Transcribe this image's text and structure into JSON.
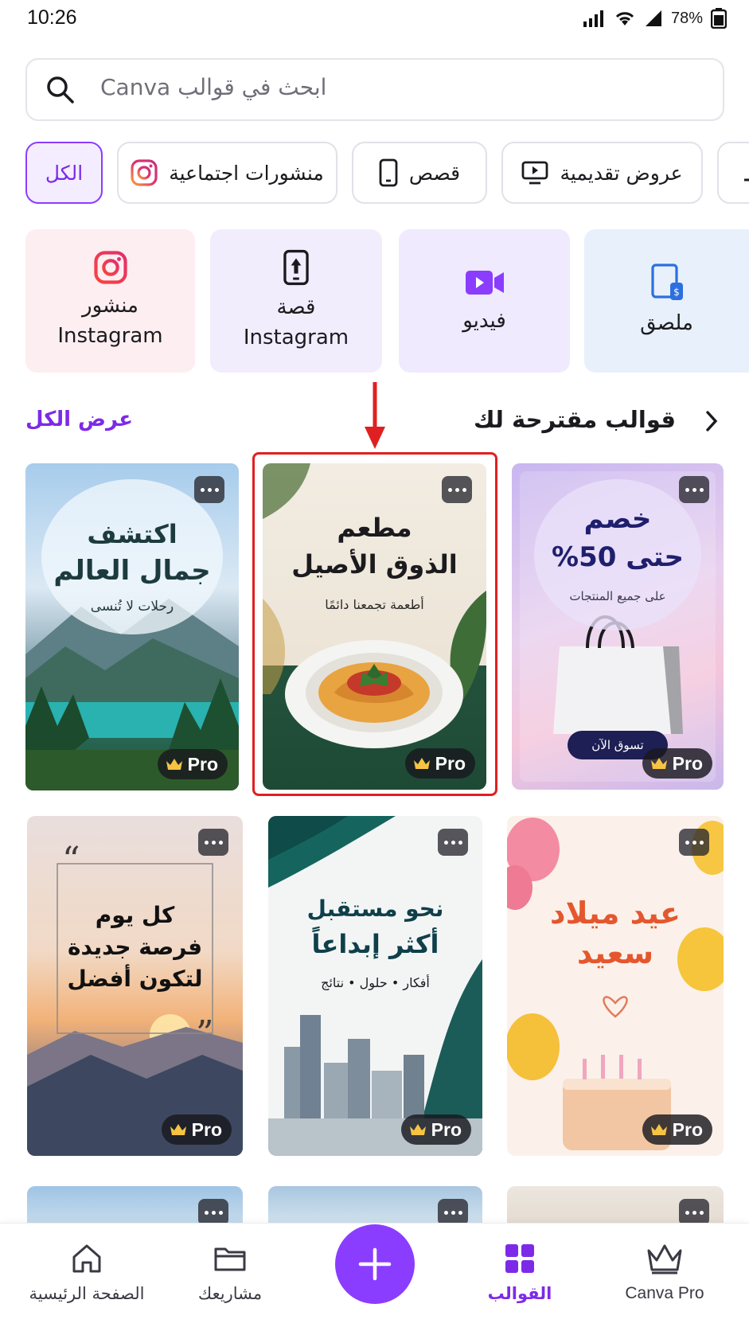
{
  "status_bar": {
    "time": "10:26",
    "battery": "78%"
  },
  "search": {
    "placeholder": "ابحث في قوالب Canva"
  },
  "chips": [
    {
      "label": "الكل",
      "active": true
    },
    {
      "label": "منشورات اجتماعية",
      "icon": "instagram-icon"
    },
    {
      "label": "قصص",
      "icon": "phone-icon"
    },
    {
      "label": "عروض تقديمية",
      "icon": "presentation-icon"
    }
  ],
  "categories": [
    {
      "line1": "منشور",
      "line2": "Instagram",
      "icon": "instagram-icon"
    },
    {
      "line1": "قصة",
      "line2": "Instagram",
      "icon": "phone-story-icon"
    },
    {
      "line1": "فيديو",
      "line2": "",
      "icon": "video-camera-icon"
    },
    {
      "line1": "ملصق",
      "line2": "",
      "icon": "poster-icon"
    }
  ],
  "section": {
    "title": "قوالب مقترحة لك",
    "see_all": "عرض الكل"
  },
  "templates": [
    {
      "title1": "اكتشف",
      "title2": "جمال العالم",
      "subtitle": "رحلات لا تُنسى",
      "badge": "Pro"
    },
    {
      "title1": "مطعم",
      "title2": "الذوق الأصيل",
      "subtitle": "أطعمة تجمعنا دائمًا",
      "badge": "Pro"
    },
    {
      "title1": "خصم",
      "title2": "حتى 50%",
      "subtitle": "على جميع المنتجات",
      "button": "تسوق الآن",
      "badge": "Pro"
    },
    {
      "title1": "كل يوم",
      "title2": "فرصة جديدة",
      "title3": "لتكون أفضل",
      "badge": "Pro"
    },
    {
      "title1": "نحو مستقبل",
      "title2": "أكثر إبداعاً",
      "subtitle": "أفكار • حلول • نتائج",
      "badge": "Pro"
    },
    {
      "title1": "عيد ميلاد",
      "title2": "سعيد",
      "badge": "Pro"
    }
  ],
  "bottom_nav": {
    "home": "الصفحة الرئيسية",
    "projects": "مشاريعك",
    "templates": "القوالب",
    "pro": "Canva Pro"
  },
  "colors": {
    "accent": "#8b3dff",
    "highlight": "#e02020"
  }
}
